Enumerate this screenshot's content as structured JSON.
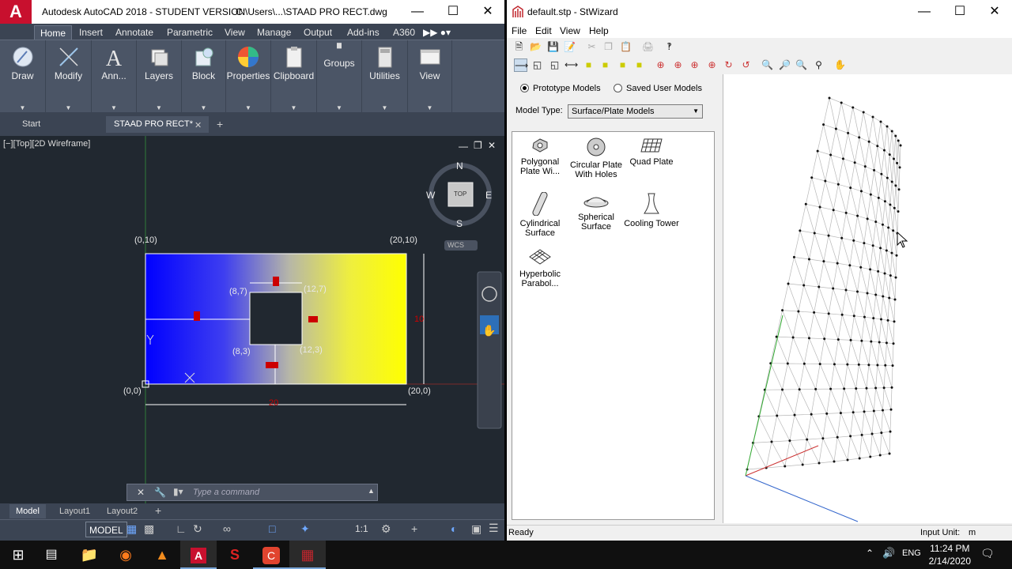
{
  "acad": {
    "logo": "A",
    "title": "Autodesk AutoCAD 2018 - STUDENT VERSION",
    "path": "C:\\Users\\...\\STAAD PRO RECT.dwg",
    "ribbon_tabs": [
      "Home",
      "Insert",
      "Annotate",
      "Parametric",
      "View",
      "Manage",
      "Output",
      "Add-ins",
      "A360"
    ],
    "panels": [
      "Draw",
      "Modify",
      "Ann...",
      "Layers",
      "Block",
      "Properties",
      "Clipboard",
      "Groups",
      "Utilities",
      "View"
    ],
    "doc_tabs": {
      "start": "Start",
      "file": "STAAD PRO RECT*"
    },
    "view_label": "[−][Top][2D Wireframe]",
    "viewcube": {
      "n": "N",
      "s": "S",
      "e": "E",
      "w": "W",
      "top": "TOP",
      "wcs": "WCS"
    },
    "labels": {
      "p010": "(0,10)",
      "p2010": "(20,10)",
      "p00": "(0,0)",
      "p200": "(20,0)",
      "p87": "(8,7)",
      "p127": "(12,7)",
      "p83": "(8,3)",
      "p123": "(12,3)",
      "dim_w": "20",
      "dim_h": "10",
      "ucs_y": "Y",
      "ucs_x": "X"
    },
    "command_placeholder": "Type a command",
    "layout_tabs": [
      "Model",
      "Layout1",
      "Layout2"
    ],
    "status_model": "MODEL",
    "status_scale": "1:1"
  },
  "stw": {
    "title": "default.stp - StWizard",
    "menu": [
      "File",
      "Edit",
      "View",
      "Help"
    ],
    "radio_prototype": "Prototype Models",
    "radio_saved": "Saved User Models",
    "model_type_label": "Model Type:",
    "model_type_value": "Surface/Plate Models",
    "models": [
      {
        "l1": "Polygonal",
        "l2": "Plate Wi..."
      },
      {
        "l1": "Circular Plate",
        "l2": "With Holes"
      },
      {
        "l1": "Quad Plate",
        "l2": ""
      },
      {
        "l1": "Cylindrical",
        "l2": "Surface"
      },
      {
        "l1": "Spherical",
        "l2": "Surface"
      },
      {
        "l1": "Cooling Tower",
        "l2": ""
      },
      {
        "l1": "Hyperbolic",
        "l2": "Parabol..."
      }
    ],
    "status_left": "Ready",
    "status_unit": "Input Unit:",
    "status_unit_value": "m"
  },
  "taskbar": {
    "lang": "ENG",
    "time": "11:24 PM",
    "date": "2/14/2020"
  }
}
